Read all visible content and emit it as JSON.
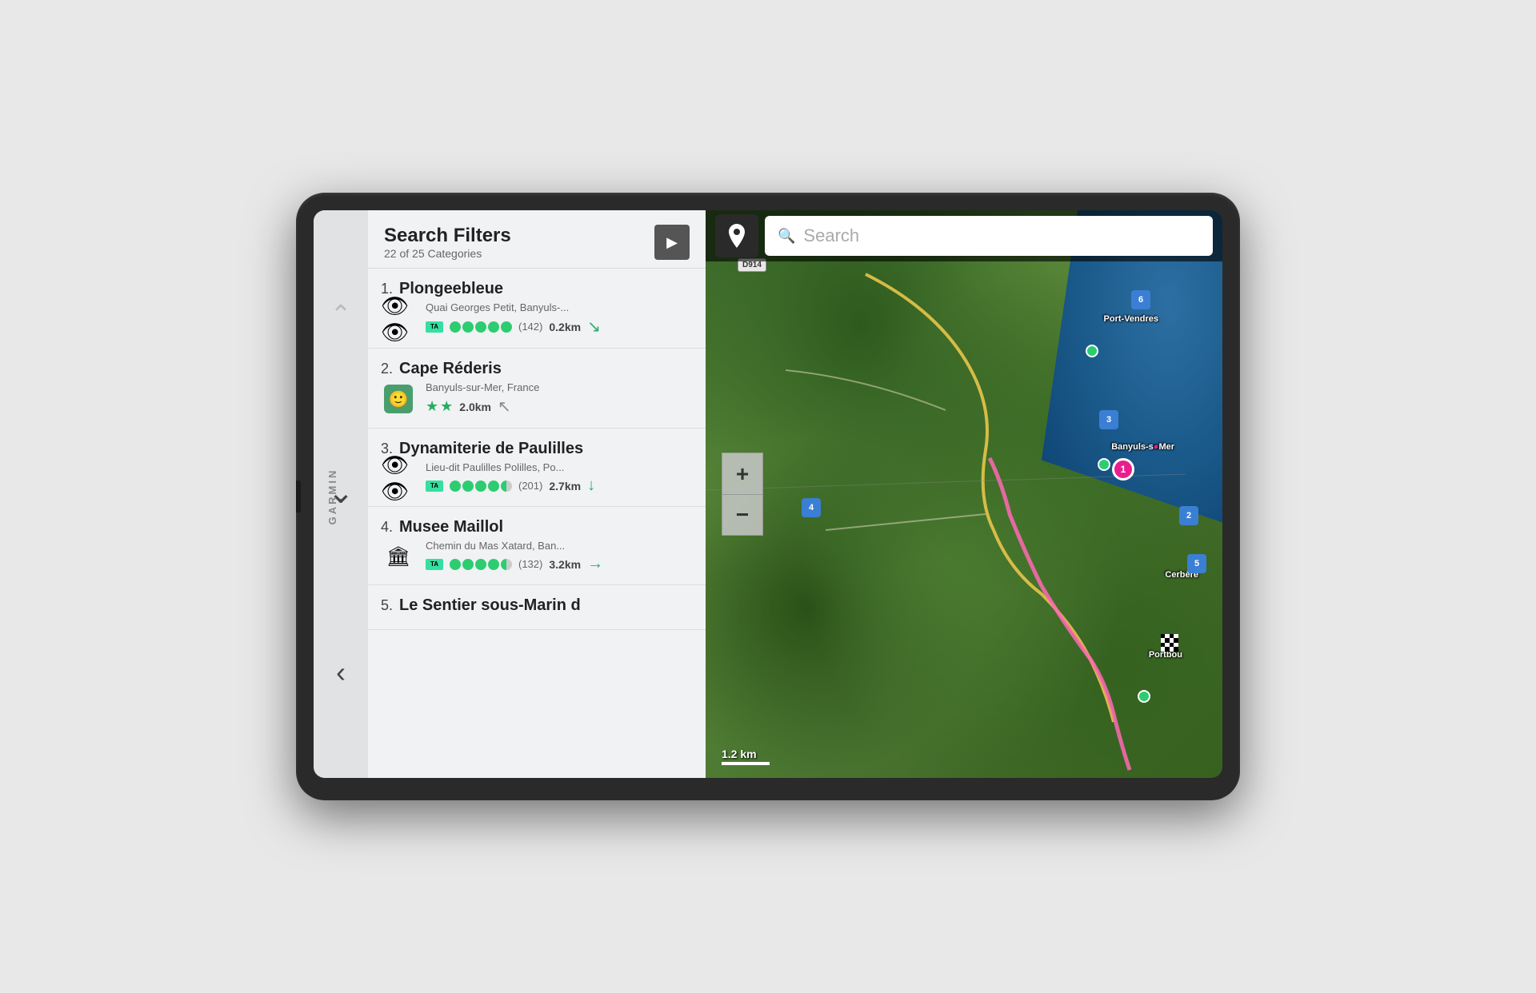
{
  "device": {
    "brand": "GARMIN"
  },
  "header": {
    "title": "Search Filters",
    "subtitle": "22 of 25 Categories",
    "arrow_label": "▶"
  },
  "results": [
    {
      "number": "1.",
      "name": "Plongeebleue",
      "address": "Quai Georges Petit, Banyuls-...",
      "icon_type": "binoculars",
      "rating_dots": [
        1,
        1,
        1,
        1,
        1,
        0
      ],
      "review_count": "(142)",
      "distance": "0.2km",
      "direction": "↓",
      "direction_color": "green"
    },
    {
      "number": "2.",
      "name": "Cape Réderis",
      "address": "Banyuls-sur-Mer, France",
      "icon_type": "michelin",
      "stars": 2,
      "review_count": "",
      "distance": "2.0km",
      "direction": "↖",
      "direction_color": "gray"
    },
    {
      "number": "3.",
      "name": "Dynamiterie de Paulilles",
      "address": "Lieu-dit Paulilles Polilles, Po...",
      "icon_type": "binoculars",
      "rating_dots": [
        1,
        1,
        1,
        1,
        0.5,
        0
      ],
      "review_count": "(201)",
      "distance": "2.7km",
      "direction": "↓",
      "direction_color": "green"
    },
    {
      "number": "4.",
      "name": "Musee Maillol",
      "address": "Chemin du Mas Xatard, Ban...",
      "icon_type": "museum",
      "rating_dots": [
        1,
        1,
        1,
        1,
        0.5,
        0
      ],
      "review_count": "(132)",
      "distance": "3.2km",
      "direction": "→",
      "direction_color": "green"
    },
    {
      "number": "5.",
      "name": "Le Sentier sous-Marin d",
      "address": "",
      "icon_type": null,
      "rating_dots": [],
      "review_count": "",
      "distance": "",
      "direction": "",
      "direction_color": ""
    }
  ],
  "search": {
    "placeholder": "Search",
    "icon": "🔍"
  },
  "map": {
    "scale_label": "1.2 km",
    "zoom_in": "+",
    "zoom_out": "−",
    "markers": [
      {
        "id": "1",
        "type": "blue",
        "label": "1"
      },
      {
        "id": "2",
        "type": "blue",
        "label": "2"
      },
      {
        "id": "3",
        "type": "blue",
        "label": "3"
      },
      {
        "id": "4",
        "type": "blue",
        "label": "4"
      },
      {
        "id": "5",
        "type": "blue",
        "label": "5"
      },
      {
        "id": "6",
        "type": "blue",
        "label": "6"
      }
    ],
    "cities": [
      "Port-Vendres",
      "Banyuls-sur-Mer",
      "Cerbère",
      "Portbou"
    ],
    "road_labels": [
      "D914"
    ]
  }
}
